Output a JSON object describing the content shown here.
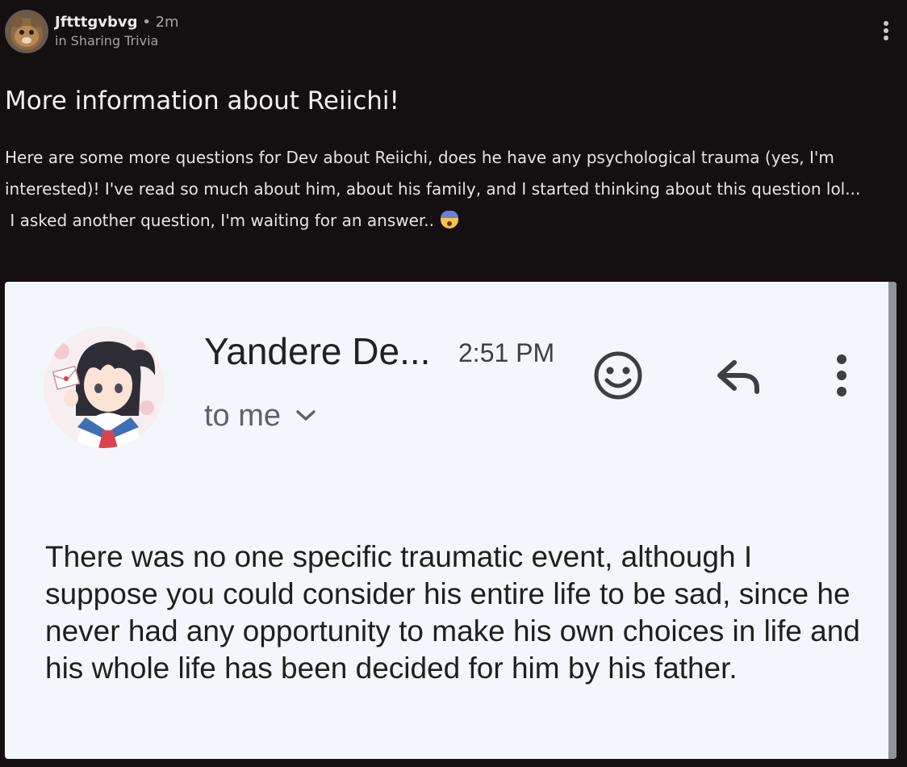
{
  "post": {
    "username": "Jftttgvbvg",
    "separator": "•",
    "time_ago": "2m",
    "community": "in Sharing Trivia",
    "title": "More information about Reiichi!",
    "body_paragraph_1": "Here are some more questions for Dev about Reiichi, does he have any psychological trauma (yes, I'm interested)! I've read so much about him, about his family, and I started thinking about this question lol...",
    "body_paragraph_2": "I asked another question, I'm waiting for an answer.."
  },
  "attachment": {
    "sender_name": "Yandere De...",
    "sent_time": "2:51 PM",
    "recipient": "to me",
    "message": "There was no one specific traumatic event, although I suppose you could consider his entire life to be sad, since he never had any opportunity to make his own choices in life and his whole life has been decided for him by his father."
  },
  "icons": {
    "post_menu": "more-vertical-icon",
    "emoji": "fearful-face-emoji",
    "reaction": "smiley-face-icon",
    "reply": "reply-arrow-icon",
    "email_menu": "more-vertical-icon",
    "expand": "chevron-down-icon"
  },
  "colors": {
    "page_background": "#140f11",
    "attachment_background": "#f3f6fa"
  }
}
